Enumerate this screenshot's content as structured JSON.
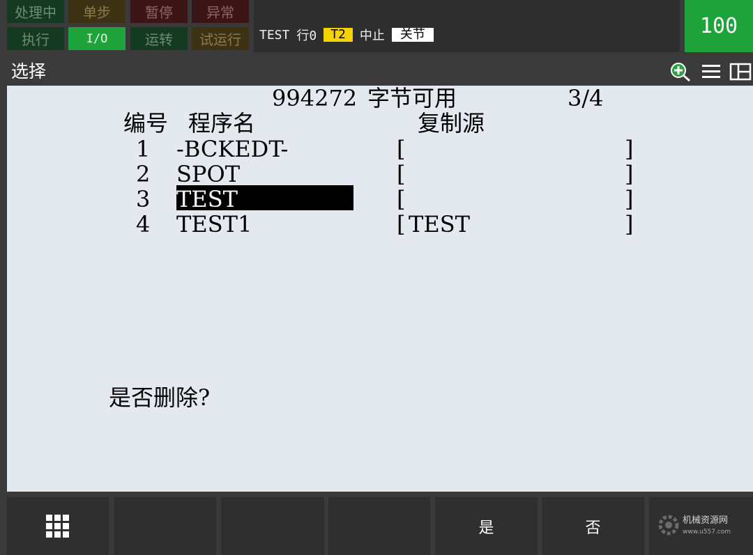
{
  "status": {
    "row1": [
      "处理中",
      "单步",
      "暂停",
      "异常"
    ],
    "row2": [
      "执行",
      "I/O",
      "运转",
      "试运行"
    ]
  },
  "topbar": {
    "program": "TEST",
    "line": "行0",
    "mode": "T2",
    "state": "中止",
    "coord": "关节"
  },
  "override": "100",
  "title": "选择",
  "icons": [
    "zoom-in-icon",
    "menu-icon",
    "split-view-icon"
  ],
  "header": {
    "bytes": "994272",
    "bytes_label": "字节可用",
    "page": "3/4",
    "col_no": "编号",
    "col_name": "程序名",
    "col_src": "复制源"
  },
  "rows": [
    {
      "no": "1",
      "name": "-BCKEDT-",
      "src_open": "[",
      "src": "",
      "src_close": "]"
    },
    {
      "no": "2",
      "name": "SPOT",
      "src_open": "[",
      "src": "",
      "src_close": "]"
    },
    {
      "no": "3",
      "name": "TEST",
      "src_open": "[",
      "src": "",
      "src_close": "]"
    },
    {
      "no": "4",
      "name": "TEST1",
      "src_open": "[",
      "src": "TEST",
      "src_close": "]"
    }
  ],
  "selected_row": 3,
  "prompt": "是否删除?",
  "fkeys": [
    "",
    "",
    "",
    "",
    "是",
    "否",
    ""
  ],
  "watermark": {
    "name": "机械资源网",
    "url": "www.u557.com"
  },
  "colors": {
    "accent_green": "#1fa33b",
    "selection": "#000000",
    "content_bg": "#e4e8ef"
  }
}
